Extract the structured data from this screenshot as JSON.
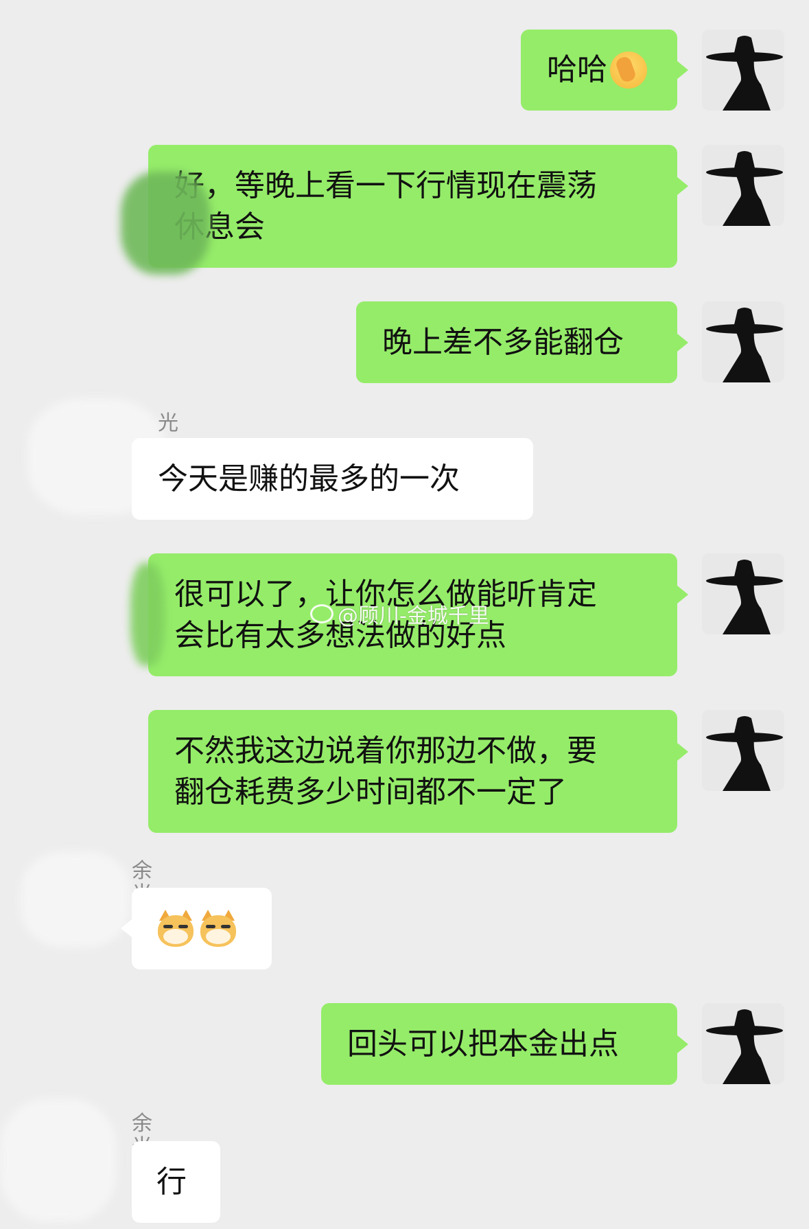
{
  "messages": [
    {
      "side": "out",
      "text": "哈哈",
      "emoji": "facepalm-emoji"
    },
    {
      "side": "out",
      "text": "好，等晚上看一下行情现在震荡\n休息会"
    },
    {
      "side": "out",
      "text": "晚上差不多能翻仓"
    },
    {
      "side": "in",
      "sender": "光",
      "text": "今天是赚的最多的一次"
    },
    {
      "side": "out",
      "text": "很可以了，让你怎么做能听肯定\n会比有太多想法做的好点"
    },
    {
      "side": "out",
      "text": "不然我这边说着你那边不做，要\n翻仓耗费多少时间都不一定了"
    },
    {
      "side": "in",
      "sender": "余光",
      "stickers": [
        "doge-emoji",
        "doge-emoji"
      ]
    },
    {
      "side": "out",
      "text": "回头可以把本金出点"
    },
    {
      "side": "in",
      "sender": "余光",
      "text": "行"
    }
  ],
  "watermark": {
    "text": "@顾川-金城千里",
    "icon": "weibo-icon"
  },
  "colors": {
    "background": "#ededed",
    "outgoing_bubble": "#95ec69",
    "incoming_bubble": "#ffffff"
  }
}
